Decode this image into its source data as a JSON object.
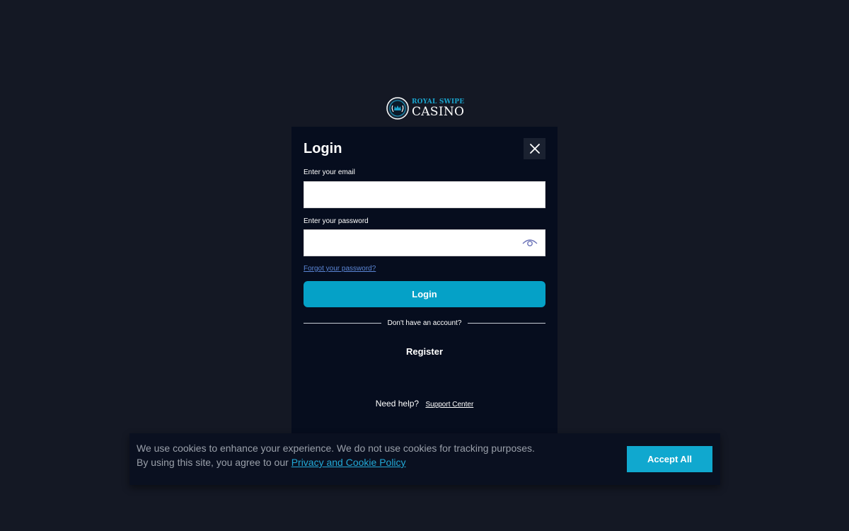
{
  "brand": {
    "logo_top": "ROYAL SWIPE",
    "logo_bottom": "CASINO",
    "accent_color": "#05a1c7"
  },
  "login_modal": {
    "title": "Login",
    "email_label": "Enter your email",
    "email_value": "",
    "password_label": "Enter your password",
    "password_value": "",
    "forgot_link": "Forgot your password?",
    "login_button": "Login",
    "no_account_text": "Don't have an account?",
    "register_button": "Register",
    "help_text": "Need help?",
    "support_link": "Support Center",
    "icons": {
      "close": "close-icon",
      "password_visibility": "eye-icon"
    }
  },
  "cookie_banner": {
    "line1": "We use cookies to enhance your experience. We do not use cookies for tracking purposes.",
    "line2_prefix": "By using this site, you agree to our",
    "policy_link": "Privacy and Cookie Policy",
    "accept_button": "Accept All"
  }
}
